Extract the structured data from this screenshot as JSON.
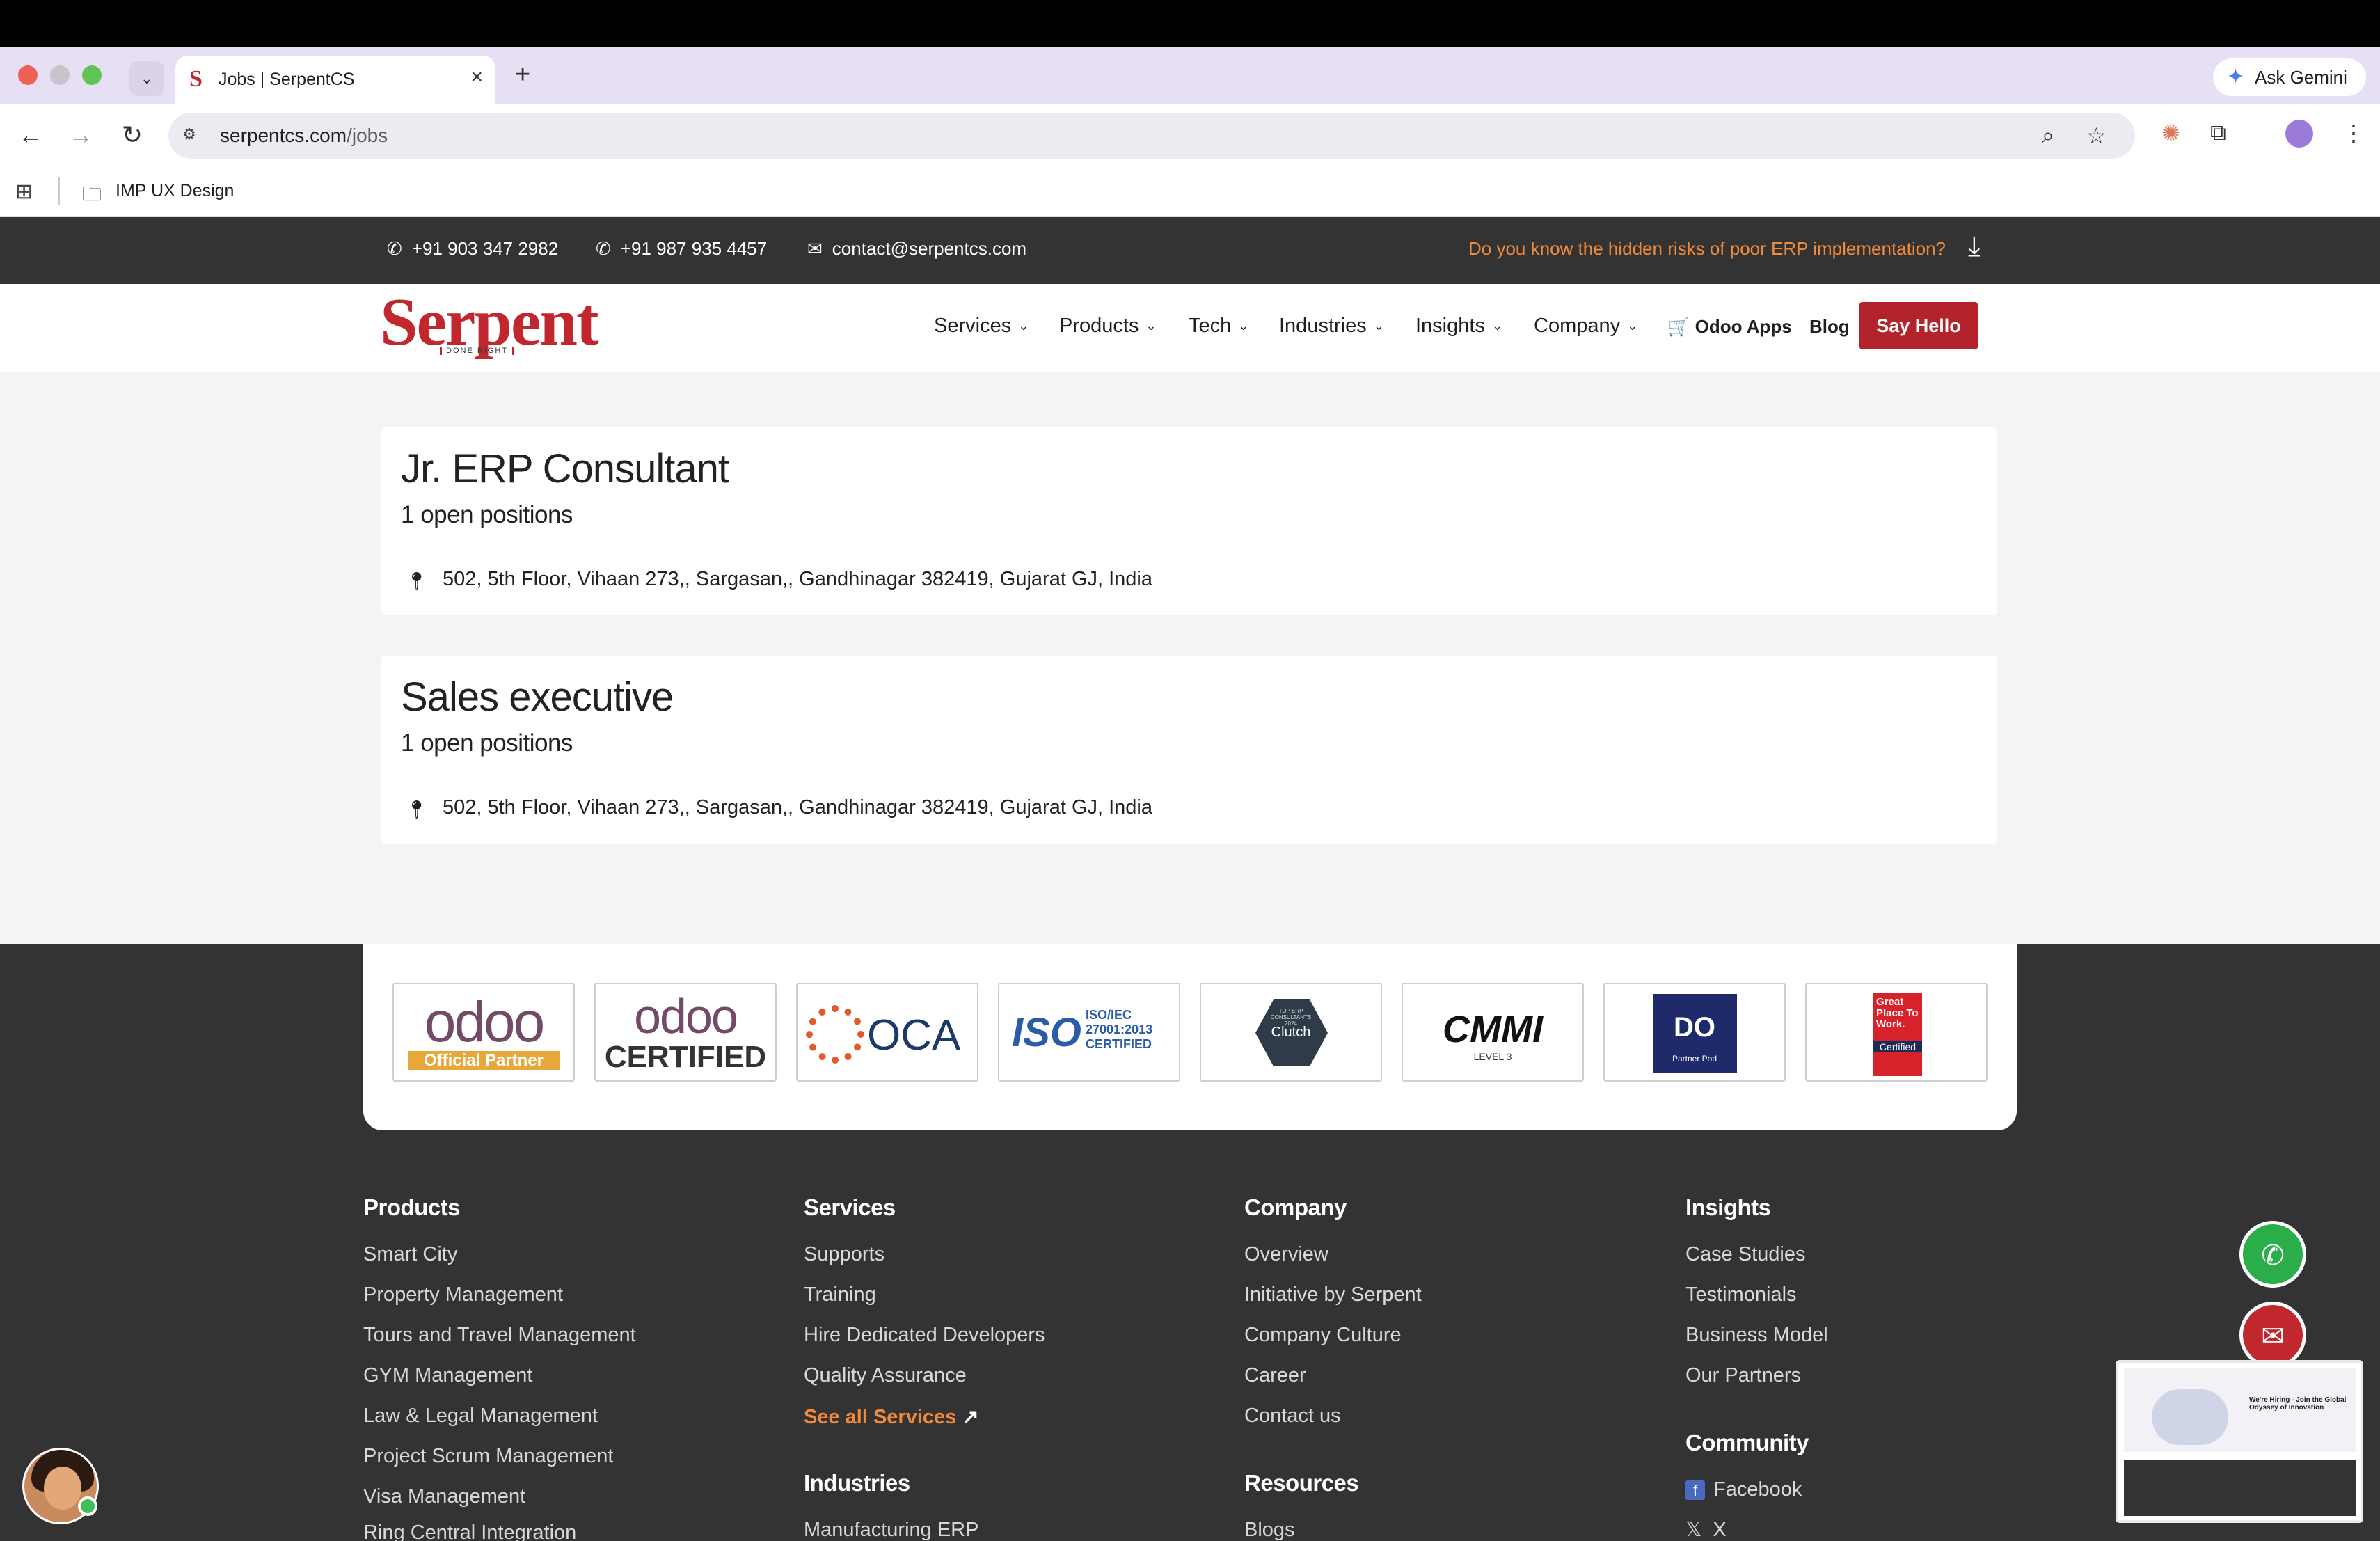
{
  "browser": {
    "tab_title": "Jobs | SerpentCS",
    "tab_favicon": "S",
    "new_tab_label": "+",
    "gemini_label": "Ask Gemini",
    "url_host": "serpentcs.com",
    "url_path": "/jobs",
    "bookmark_folder": "IMP UX Design"
  },
  "topbar": {
    "phone1": "+91 903 347 2982",
    "phone2": "+91 987 935 4457",
    "email": "contact@serpentcs.com",
    "promo": "Do you know the hidden risks of poor ERP implementation?"
  },
  "nav": {
    "logo_text": "Serpent",
    "logo_tag": "DONE RIGHT",
    "items": [
      {
        "label": "Services"
      },
      {
        "label": "Products"
      },
      {
        "label": "Tech"
      },
      {
        "label": "Industries"
      },
      {
        "label": "Insights"
      },
      {
        "label": "Company"
      }
    ],
    "odoo_apps": "Odoo Apps",
    "blog": "Blog",
    "cta": "Say Hello"
  },
  "jobs": [
    {
      "title": "Jr. ERP Consultant",
      "positions": "1 open positions",
      "address": "502, 5th Floor, Vihaan 273,, Sargasan,, Gandhinagar 382419, Gujarat GJ, India"
    },
    {
      "title": "Sales executive",
      "positions": "1 open positions",
      "address": "502, 5th Floor, Vihaan 273,, Sargasan,, Gandhinagar 382419, Gujarat GJ, India"
    }
  ],
  "badges": [
    {
      "main": "odoo",
      "sub": "Official Partner"
    },
    {
      "main": "odoo",
      "sub": "CERTIFIED"
    },
    {
      "main": "OCA",
      "sub": ""
    },
    {
      "main": "ISO",
      "sub": "ISO/IEC 27001:2013 CERTIFIED"
    },
    {
      "main": "Clutch",
      "sub": "TOP ERP CONSULTANTS 2024"
    },
    {
      "main": "CMMI",
      "sub": "LEVEL 3"
    },
    {
      "main": "DO",
      "sub": "Partner Pod"
    },
    {
      "main": "Great Place To Work.",
      "sub": "Certified"
    }
  ],
  "footer": {
    "products": {
      "heading": "Products",
      "links": [
        "Smart City",
        "Property Management",
        "Tours and Travel Management",
        "GYM Management",
        "Law & Legal Management",
        "Project Scrum Management",
        "Visa Management",
        "Ring Central Integration"
      ]
    },
    "services": {
      "heading": "Services",
      "links": [
        "Supports",
        "Training",
        "Hire Dedicated Developers",
        "Quality Assurance"
      ],
      "see_all": "See all Services"
    },
    "industries": {
      "heading": "Industries",
      "links": [
        "Manufacturing ERP"
      ]
    },
    "company": {
      "heading": "Company",
      "links": [
        "Overview",
        "Initiative by Serpent",
        "Company Culture",
        "Career",
        "Contact us"
      ]
    },
    "resources": {
      "heading": "Resources",
      "links": [
        "Blogs"
      ]
    },
    "insights": {
      "heading": "Insights",
      "links": [
        "Case Studies",
        "Testimonials",
        "Business Model",
        "Our Partners"
      ]
    },
    "community": {
      "heading": "Community",
      "links": [
        "Facebook",
        "X"
      ]
    }
  },
  "preview": {
    "heading": "We're Hiring - Join the Global Odyssey of Innovation"
  },
  "colors": {
    "brand_red": "#c0282e",
    "accent_orange": "#f08a3c",
    "dark": "#333333",
    "whatsapp": "#2aae4a"
  }
}
